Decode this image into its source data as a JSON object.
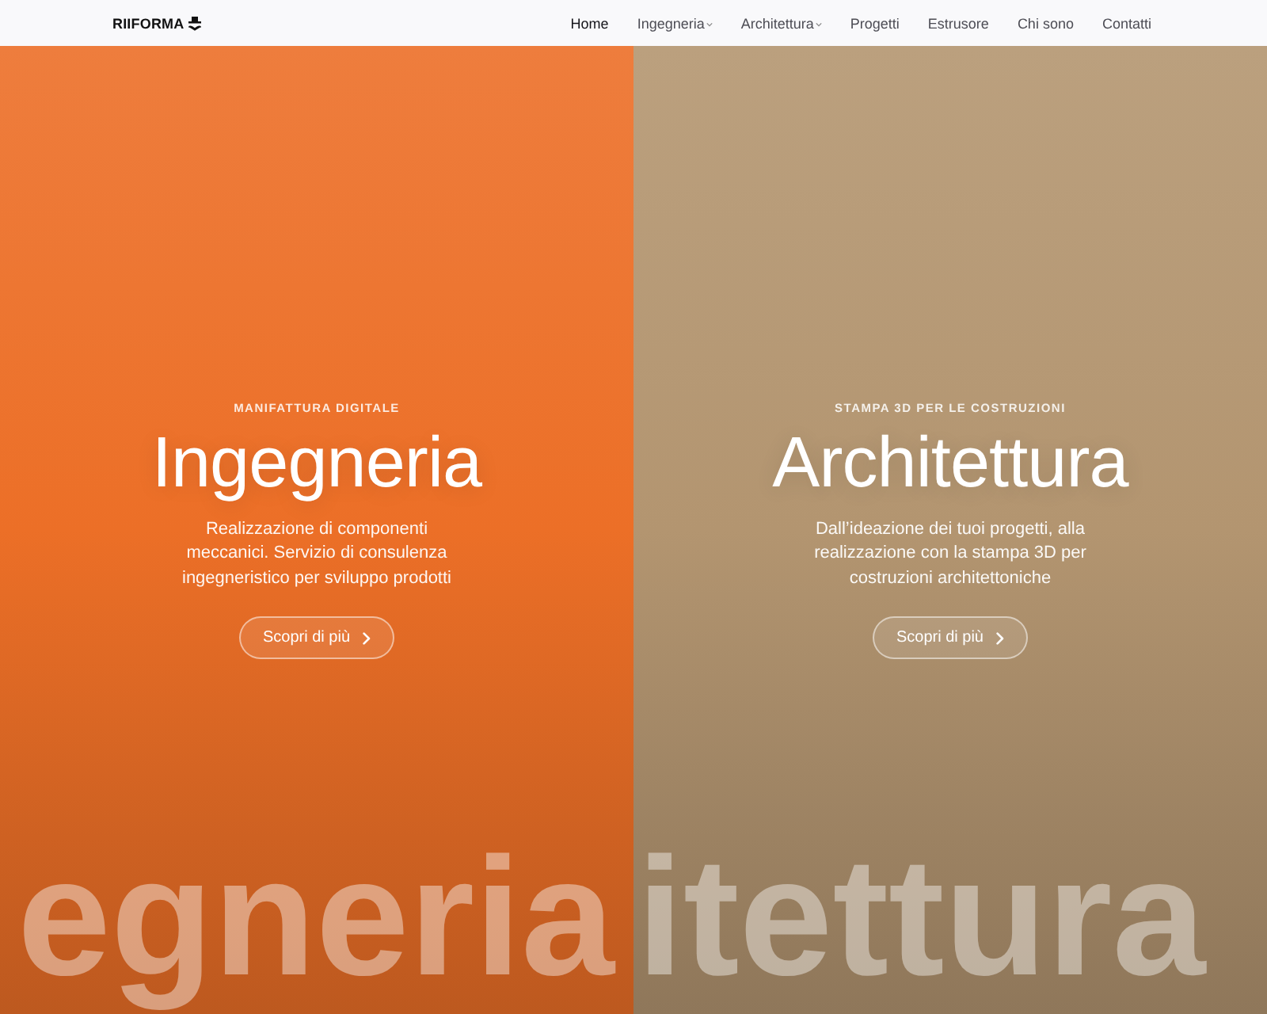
{
  "header": {
    "logo": "RIIFORMA",
    "nav": [
      {
        "label": "Home",
        "selected": true,
        "dropdown": false
      },
      {
        "label": "Ingegneria",
        "selected": false,
        "dropdown": true
      },
      {
        "label": "Architettura",
        "selected": false,
        "dropdown": true
      },
      {
        "label": "Progetti",
        "selected": false,
        "dropdown": false
      },
      {
        "label": "Estrusore",
        "selected": false,
        "dropdown": false
      },
      {
        "label": "Chi sono",
        "selected": false,
        "dropdown": false
      },
      {
        "label": "Contatti",
        "selected": false,
        "dropdown": false
      }
    ]
  },
  "panels": [
    {
      "color": "#ec6f27",
      "eyebrow": "MANIFATTURA DIGITALE",
      "title": "Ingegneria",
      "description": "Realizzazione di componenti meccanici. Servizio di consulenza ingegneristico per sviluppo prodotti",
      "button": "Scopri di più",
      "background_word": "egneria"
    },
    {
      "color": "#b39570",
      "eyebrow": "STAMPA 3D PER LE COSTRUZIONI",
      "title": "Architettura",
      "description": "Dall’ideazione dei tuoi progetti, alla realizzazione con la stampa 3D per costruzioni architettoniche",
      "button": "Scopri di più",
      "background_word": "itettura"
    }
  ]
}
